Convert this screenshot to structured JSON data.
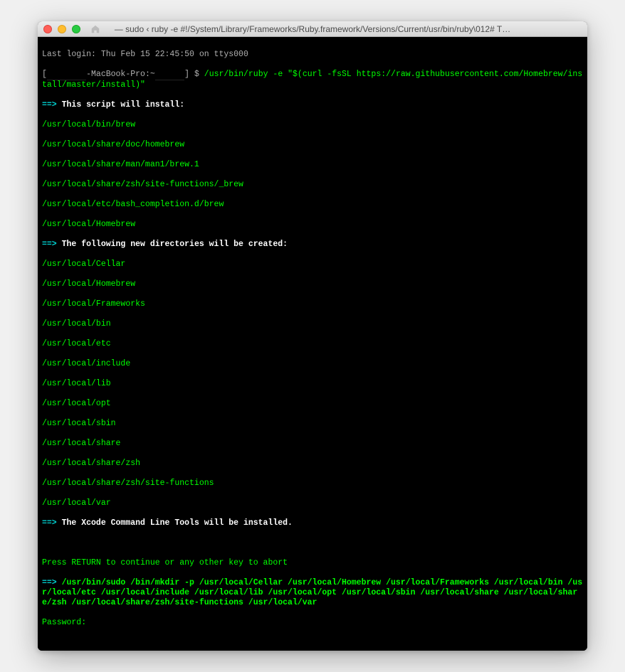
{
  "window": {
    "title": "— sudo ‹ ruby -e #!/System/Library/Frameworks/Ruby.framework/Versions/Current/usr/bin/ruby\\012# T…"
  },
  "login": {
    "last_login": "Last login: Thu Feb 15 22:45:50 on ttys000",
    "prompt_host": "-MacBook-Pro:~",
    "prompt_symbol": "$ ",
    "command": "/usr/bin/ruby -e \"$(curl -fsSL https://raw.githubusercontent.com/Homebrew/install/master/install)\""
  },
  "sections": {
    "install_header": {
      "arrow": "==> ",
      "text": "This script will install:"
    },
    "install_paths": [
      "/usr/local/bin/brew",
      "/usr/local/share/doc/homebrew",
      "/usr/local/share/man/man1/brew.1",
      "/usr/local/share/zsh/site-functions/_brew",
      "/usr/local/etc/bash_completion.d/brew",
      "/usr/local/Homebrew"
    ],
    "newdirs_header": {
      "arrow": "==> ",
      "text": "The following new directories will be created:"
    },
    "newdirs_paths": [
      "/usr/local/Cellar",
      "/usr/local/Homebrew",
      "/usr/local/Frameworks",
      "/usr/local/bin",
      "/usr/local/etc",
      "/usr/local/include",
      "/usr/local/lib",
      "/usr/local/opt",
      "/usr/local/sbin",
      "/usr/local/share",
      "/usr/local/share/zsh",
      "/usr/local/share/zsh/site-functions",
      "/usr/local/var"
    ],
    "xcode_header": {
      "arrow": "==> ",
      "text": "The Xcode Command Line Tools will be installed."
    },
    "prompt_continue": "Press RETURN to continue or any other key to abort",
    "mkdir_header": {
      "arrow": "==> ",
      "command": "/usr/bin/sudo /bin/mkdir -p /usr/local/Cellar /usr/local/Homebrew /usr/local/Frameworks /usr/local/bin /usr/local/etc /usr/local/include /usr/local/lib /usr/local/opt /usr/local/sbin /usr/local/share /usr/local/share/zsh /usr/local/share/zsh/site-functions /usr/local/var"
    },
    "password_prompt": "Password:"
  }
}
